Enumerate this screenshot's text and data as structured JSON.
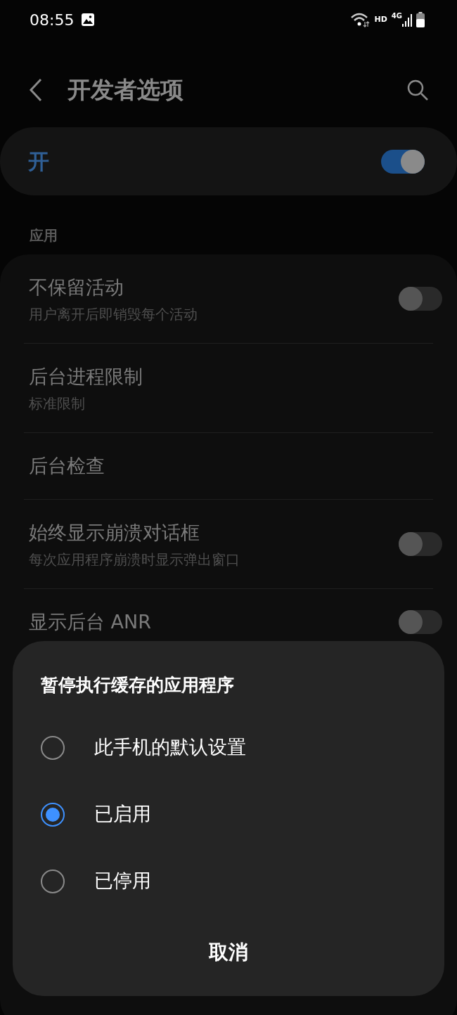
{
  "status_bar": {
    "time": "08:55",
    "hd": "HD",
    "network": "4G"
  },
  "header": {
    "title": "开发者选项"
  },
  "master": {
    "label": "开",
    "on": true
  },
  "section": {
    "title": "应用",
    "items": [
      {
        "kind": "toggle",
        "title": "不保留活动",
        "subtitle": "用户离开后即销毁每个活动",
        "on": false
      },
      {
        "kind": "plain",
        "title": "后台进程限制",
        "subtitle": "标准限制"
      },
      {
        "kind": "plain",
        "title": "后台检查"
      },
      {
        "kind": "toggle",
        "title": "始终显示崩溃对话框",
        "subtitle": "每次应用程序崩溃时显示弹出窗口",
        "on": false
      },
      {
        "kind": "toggle",
        "title": "显示后台 ANR",
        "on": false
      }
    ]
  },
  "dialog": {
    "title": "暂停执行缓存的应用程序",
    "options": [
      {
        "label": "此手机的默认设置",
        "selected": false
      },
      {
        "label": "已启用",
        "selected": true
      },
      {
        "label": "已停用",
        "selected": false
      }
    ],
    "buttons": [
      "取消"
    ]
  }
}
